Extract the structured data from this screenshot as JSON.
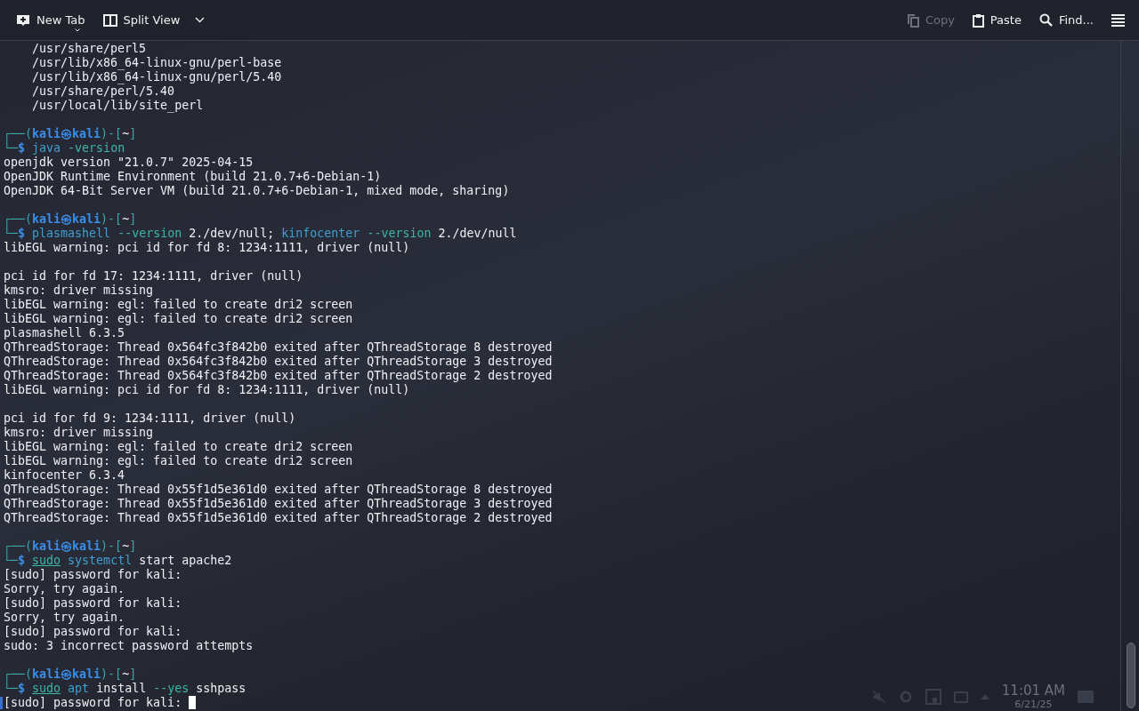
{
  "toolbar": {
    "left": [
      {
        "kind": "newtab",
        "label": "New Tab",
        "disabled": false
      },
      {
        "kind": "split",
        "label": "Split View",
        "disabled": false
      }
    ],
    "right": [
      {
        "kind": "copy",
        "label": "Copy",
        "disabled": true
      },
      {
        "kind": "paste",
        "label": "Paste",
        "disabled": false
      },
      {
        "kind": "find",
        "label": "Find...",
        "disabled": false
      }
    ]
  },
  "terminal": {
    "lines": [
      {
        "kind": "output",
        "text": "    /usr/share/perl5"
      },
      {
        "kind": "output",
        "text": "    /usr/lib/x86_64-linux-gnu/perl-base"
      },
      {
        "kind": "output",
        "text": "    /usr/lib/x86_64-linux-gnu/perl/5.40"
      },
      {
        "kind": "output",
        "text": "    /usr/share/perl/5.40"
      },
      {
        "kind": "output",
        "text": "    /usr/local/lib/site_perl"
      },
      {
        "kind": "blank"
      },
      {
        "kind": "prompt",
        "open": "┌──(",
        "user": "kali",
        "at": "㉿",
        "host": "kali",
        "sep": ")-[",
        "dir": "~",
        "close": "]"
      },
      {
        "kind": "command",
        "prefix": "└─$",
        "tokens": [
          {
            "kind": "cmd",
            "text": "java"
          },
          {
            "kind": "option",
            "text": "-version"
          }
        ]
      },
      {
        "kind": "output",
        "text": "openjdk version \"21.0.7\" 2025-04-15"
      },
      {
        "kind": "output",
        "text": "OpenJDK Runtime Environment (build 21.0.7+6-Debian-1)"
      },
      {
        "kind": "output",
        "text": "OpenJDK 64-Bit Server VM (build 21.0.7+6-Debian-1, mixed mode, sharing)"
      },
      {
        "kind": "blank"
      },
      {
        "kind": "prompt",
        "open": "┌──(",
        "user": "kali",
        "at": "㉿",
        "host": "kali",
        "sep": ")-[",
        "dir": "~",
        "close": "]"
      },
      {
        "kind": "command",
        "prefix": "└─$",
        "tokens": [
          {
            "kind": "cmd",
            "text": "plasmashell"
          },
          {
            "kind": "option",
            "text": "--version"
          },
          {
            "kind": "arg",
            "text": "2./dev/null;"
          },
          {
            "kind": "cmd",
            "text": "kinfocenter"
          },
          {
            "kind": "option",
            "text": "--version"
          },
          {
            "kind": "arg",
            "text": "2./dev/null"
          }
        ]
      },
      {
        "kind": "output",
        "text": "libEGL warning: pci id for fd 8: 1234:1111, driver (null)"
      },
      {
        "kind": "blank"
      },
      {
        "kind": "output",
        "text": "pci id for fd 17: 1234:1111, driver (null)"
      },
      {
        "kind": "output",
        "text": "kmsro: driver missing"
      },
      {
        "kind": "output",
        "text": "libEGL warning: egl: failed to create dri2 screen"
      },
      {
        "kind": "output",
        "text": "libEGL warning: egl: failed to create dri2 screen"
      },
      {
        "kind": "output",
        "text": "plasmashell 6.3.5"
      },
      {
        "kind": "output",
        "text": "QThreadStorage: Thread 0x564fc3f842b0 exited after QThreadStorage 8 destroyed"
      },
      {
        "kind": "output",
        "text": "QThreadStorage: Thread 0x564fc3f842b0 exited after QThreadStorage 3 destroyed"
      },
      {
        "kind": "output",
        "text": "QThreadStorage: Thread 0x564fc3f842b0 exited after QThreadStorage 2 destroyed"
      },
      {
        "kind": "output",
        "text": "libEGL warning: pci id for fd 8: 1234:1111, driver (null)"
      },
      {
        "kind": "blank"
      },
      {
        "kind": "output",
        "text": "pci id for fd 9: 1234:1111, driver (null)"
      },
      {
        "kind": "output",
        "text": "kmsro: driver missing"
      },
      {
        "kind": "output",
        "text": "libEGL warning: egl: failed to create dri2 screen"
      },
      {
        "kind": "output",
        "text": "libEGL warning: egl: failed to create dri2 screen"
      },
      {
        "kind": "output",
        "text": "kinfocenter 6.3.4"
      },
      {
        "kind": "output",
        "text": "QThreadStorage: Thread 0x55f1d5e361d0 exited after QThreadStorage 8 destroyed"
      },
      {
        "kind": "output",
        "text": "QThreadStorage: Thread 0x55f1d5e361d0 exited after QThreadStorage 3 destroyed"
      },
      {
        "kind": "output",
        "text": "QThreadStorage: Thread 0x55f1d5e361d0 exited after QThreadStorage 2 destroyed"
      },
      {
        "kind": "blank"
      },
      {
        "kind": "prompt",
        "open": "┌──(",
        "user": "kali",
        "at": "㉿",
        "host": "kali",
        "sep": ")-[",
        "dir": "~",
        "close": "]"
      },
      {
        "kind": "command",
        "prefix": "└─$",
        "tokens": [
          {
            "kind": "sudo",
            "text": "sudo"
          },
          {
            "kind": "cmd",
            "text": "systemctl"
          },
          {
            "kind": "arg",
            "text": "start apache2"
          }
        ]
      },
      {
        "kind": "output",
        "text": "[sudo] password for kali:"
      },
      {
        "kind": "output",
        "text": "Sorry, try again."
      },
      {
        "kind": "output",
        "text": "[sudo] password for kali:"
      },
      {
        "kind": "output",
        "text": "Sorry, try again."
      },
      {
        "kind": "output",
        "text": "[sudo] password for kali:"
      },
      {
        "kind": "output",
        "text": "sudo: 3 incorrect password attempts"
      },
      {
        "kind": "blank"
      },
      {
        "kind": "prompt",
        "open": "┌──(",
        "user": "kali",
        "at": "㉿",
        "host": "kali",
        "sep": ")-[",
        "dir": "~",
        "close": "]"
      },
      {
        "kind": "command",
        "prefix": "└─$",
        "tokens": [
          {
            "kind": "sudo",
            "text": "sudo"
          },
          {
            "kind": "cmd",
            "text": "apt"
          },
          {
            "kind": "arg",
            "text": "install"
          },
          {
            "kind": "option",
            "text": "--yes"
          },
          {
            "kind": "arg",
            "text": "sshpass"
          }
        ]
      },
      {
        "kind": "input",
        "text": "[sudo] password for kali: ",
        "cursor": true
      }
    ]
  },
  "tray": {
    "time": "11:01 AM",
    "date": "6/21/25"
  }
}
